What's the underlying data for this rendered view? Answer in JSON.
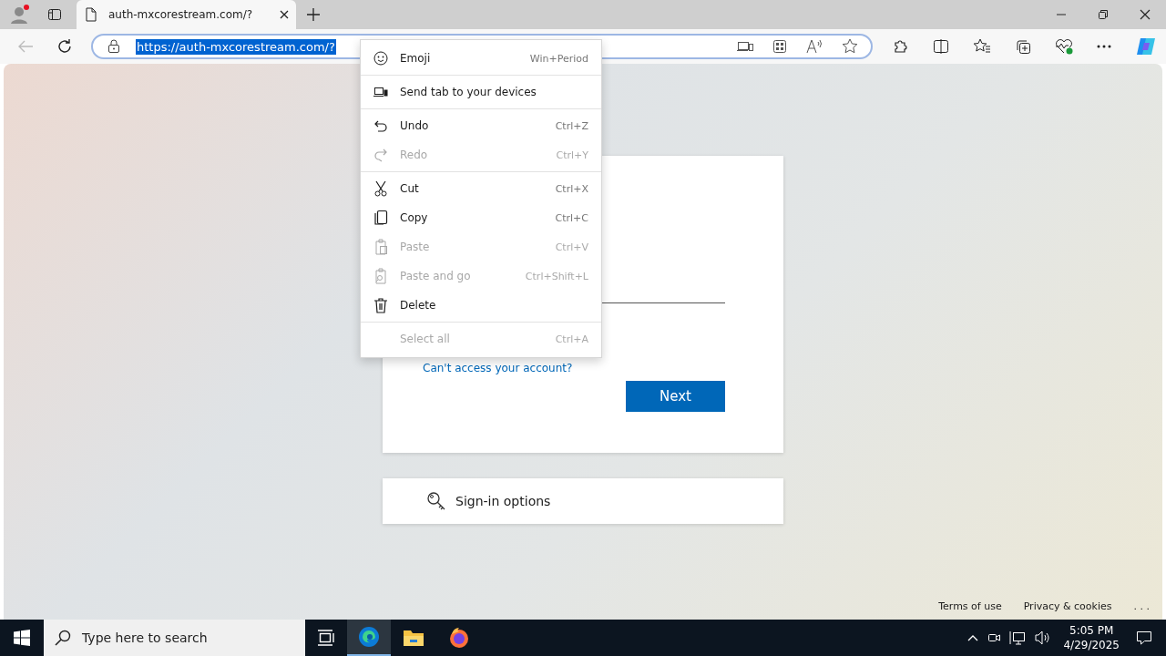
{
  "browser": {
    "tab_title": "auth-mxcorestream.com/?",
    "url": "https://auth-mxcorestream.com/?",
    "url_selected": true
  },
  "context_menu": {
    "groups": [
      [
        {
          "label": "Emoji",
          "shortcut": "Win+Period",
          "disabled": false
        }
      ],
      [
        {
          "label": "Send tab to your devices",
          "disabled": false
        }
      ],
      [
        {
          "label": "Undo",
          "shortcut": "Ctrl+Z",
          "disabled": false
        },
        {
          "label": "Redo",
          "shortcut": "Ctrl+Y",
          "disabled": true
        }
      ],
      [
        {
          "label": "Cut",
          "shortcut": "Ctrl+X",
          "disabled": false
        },
        {
          "label": "Copy",
          "shortcut": "Ctrl+C",
          "disabled": false
        },
        {
          "label": "Paste",
          "shortcut": "Ctrl+V",
          "disabled": true
        },
        {
          "label": "Paste and go",
          "shortcut": "Ctrl+Shift+L",
          "disabled": true
        },
        {
          "label": "Delete",
          "disabled": false
        }
      ],
      [
        {
          "label": "Select all",
          "shortcut": "Ctrl+A",
          "disabled": true
        }
      ]
    ]
  },
  "signin": {
    "link": "Can't access your account?",
    "next_button": "Next",
    "options": "Sign-in options"
  },
  "footer": {
    "links": [
      "Terms of use",
      "Privacy & cookies"
    ],
    "more": ". . ."
  },
  "taskbar": {
    "search_placeholder": "Type here to search",
    "time": "5:05 PM",
    "date": "4/29/2025"
  }
}
